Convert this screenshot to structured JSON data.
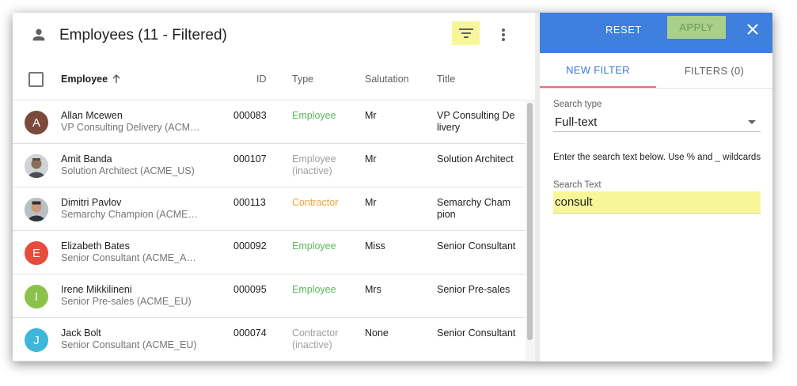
{
  "header": {
    "title": "Employees (11 - Filtered)"
  },
  "icons": {
    "person": "person-icon",
    "filter": "filter-icon",
    "more": "more-vert-icon",
    "sort": "arrow-up-icon",
    "close": "close-icon"
  },
  "colors": {
    "employee": "#5cb85c",
    "contractor": "#f0a23a",
    "inactive": "#9e9e9e",
    "accent": "#3f7fdd",
    "highlight": "#f7f79a"
  },
  "columns": {
    "employee": "Employee",
    "id": "ID",
    "type": "Type",
    "salutation": "Salutation",
    "title": "Title"
  },
  "rows": [
    {
      "name": "Allan Mcewen",
      "sub": "VP Consulting Delivery (ACME…",
      "id": "000083",
      "type": "Employee",
      "type_status": "employee",
      "salutation": "Mr",
      "title": "VP Consulting Delivery",
      "avatar_letter": "A",
      "avatar_color": "#7b4a3c"
    },
    {
      "name": "Amit Banda",
      "sub": "Solution Architect (ACME_US)",
      "id": "000107",
      "type": "Employee (inactive)",
      "type_status": "inactive",
      "salutation": "Mr",
      "title": "Solution Architect",
      "avatar_letter": "",
      "avatar_color": ""
    },
    {
      "name": "Dimitri Pavlov",
      "sub": "Semarchy Champion (ACME_E…",
      "id": "000113",
      "type": "Contractor",
      "type_status": "contractor",
      "salutation": "Mr",
      "title": "Semarchy Champion",
      "avatar_letter": "",
      "avatar_color": ""
    },
    {
      "name": "Elizabeth Bates",
      "sub": "Senior Consultant (ACME_APA…",
      "id": "000092",
      "type": "Employee",
      "type_status": "employee",
      "salutation": "Miss",
      "title": "Senior Consultant",
      "avatar_letter": "E",
      "avatar_color": "#e74c3c"
    },
    {
      "name": "Irene Mikkilineni",
      "sub": "Senior Pre-sales (ACME_EU)",
      "id": "000095",
      "type": "Employee",
      "type_status": "employee",
      "salutation": "Mrs",
      "title": "Senior Pre-sales",
      "avatar_letter": "I",
      "avatar_color": "#8bc34a"
    },
    {
      "name": "Jack Bolt",
      "sub": "Senior Consultant (ACME_EU)",
      "id": "000074",
      "type": "Contractor (inactive)",
      "type_status": "inactive",
      "salutation": "None",
      "title": "Senior Consultant",
      "avatar_letter": "J",
      "avatar_color": "#3fb6d9"
    }
  ],
  "panel": {
    "reset_label": "RESET",
    "apply_label": "APPLY",
    "tabs": [
      "NEW FILTER",
      "FILTERS (0)"
    ],
    "search_type_label": "Search type",
    "search_type_value": "Full-text",
    "hint": "Enter the search text below. Use % and _ wildcards",
    "search_text_label": "Search Text",
    "search_text_value": "consult"
  }
}
